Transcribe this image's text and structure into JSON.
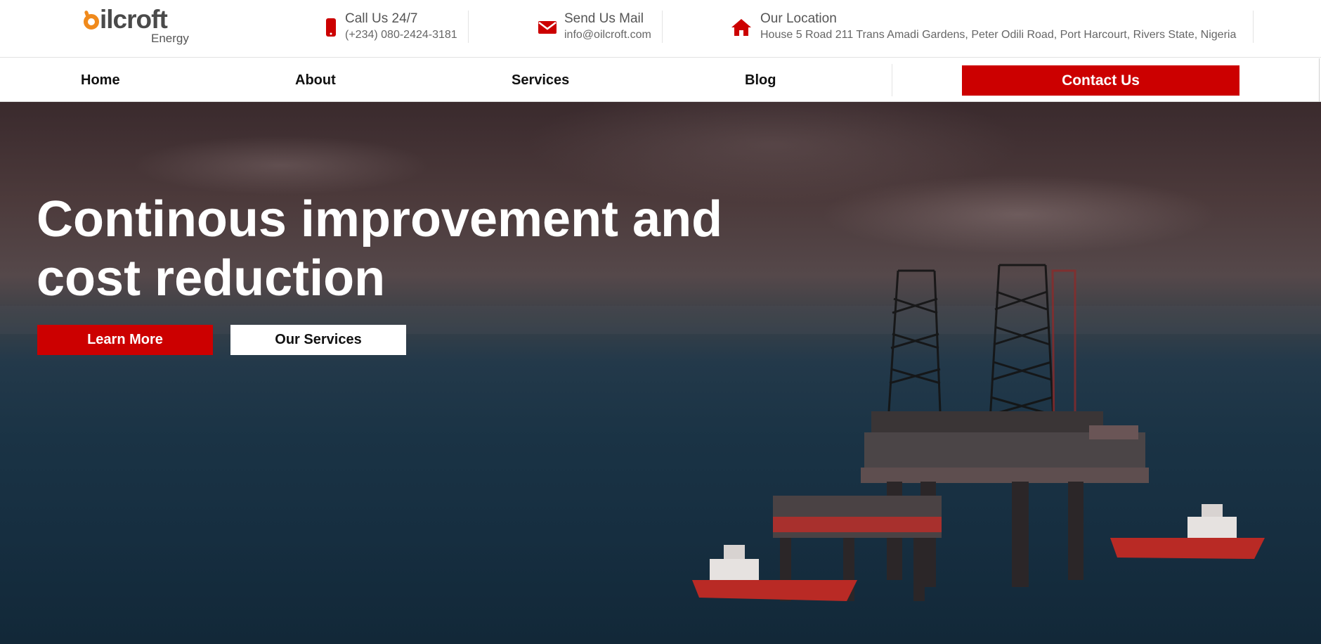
{
  "brand": {
    "logo_text": "ilcroft",
    "logo_sub": "Energy",
    "accent": "#cc0000",
    "logo_orange": "#f08a1c"
  },
  "contact_info": [
    {
      "icon": "phone-icon",
      "title": "Call Us 24/7",
      "detail": "(+234) 080-2424-3181"
    },
    {
      "icon": "envelope-icon",
      "title": "Send Us Mail",
      "detail": "info@oilcroft.com"
    },
    {
      "icon": "home-icon",
      "title": "Our Location",
      "detail": "House 5 Road 211 Trans Amadi Gardens, Peter Odili Road, Port Harcourt, Rivers State, Nigeria"
    }
  ],
  "nav": {
    "items": [
      "Home",
      "About",
      "Services",
      "Blog"
    ],
    "cta": "Contact Us"
  },
  "hero": {
    "title": "Continous improvement and cost reduction",
    "primary_button": "Learn More",
    "secondary_button": "Our Services"
  }
}
